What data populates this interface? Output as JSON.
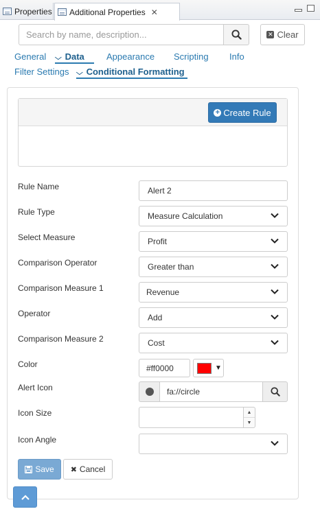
{
  "window": {
    "tabs": [
      {
        "label": "Properties"
      },
      {
        "label": "Additional Properties",
        "close_glyph": "✕"
      }
    ]
  },
  "search": {
    "placeholder": "Search by name, description...",
    "value": "",
    "clear_label": "Clear"
  },
  "nav": {
    "row1": [
      {
        "label": "General"
      },
      {
        "label": "Data",
        "active": true
      },
      {
        "label": "Appearance"
      },
      {
        "label": "Scripting"
      },
      {
        "label": "Info"
      }
    ],
    "row2": [
      {
        "label": "Filter Settings"
      },
      {
        "label": "Conditional Formatting",
        "active": true
      }
    ]
  },
  "rules": {
    "create_label": "Create Rule"
  },
  "form": {
    "rule_name": {
      "label": "Rule Name",
      "value": "Alert 2"
    },
    "rule_type": {
      "label": "Rule Type",
      "value": "Measure Calculation"
    },
    "select_measure": {
      "label": "Select Measure",
      "value": "Profit"
    },
    "comparison_operator": {
      "label": "Comparison Operator",
      "value": "Greater than"
    },
    "comparison_measure_1": {
      "label": "Comparison Measure 1",
      "value": "Revenue"
    },
    "operator": {
      "label": "Operator",
      "value": "Add"
    },
    "comparison_measure_2": {
      "label": "Comparison Measure 2",
      "value": "Cost"
    },
    "color": {
      "label": "Color",
      "value": "#ff0000",
      "swatch": "#ff0000"
    },
    "alert_icon": {
      "label": "Alert Icon",
      "value": "fa://circle"
    },
    "icon_size": {
      "label": "Icon Size",
      "value": ""
    },
    "icon_angle": {
      "label": "Icon Angle",
      "value": ""
    }
  },
  "actions": {
    "save_label": "Save",
    "cancel_label": "Cancel"
  },
  "colors": {
    "primary": "#337ab7",
    "link": "#2a7ab0",
    "save_disabled": "#7aa9d4",
    "scroll_top": "#5e9bd6"
  }
}
